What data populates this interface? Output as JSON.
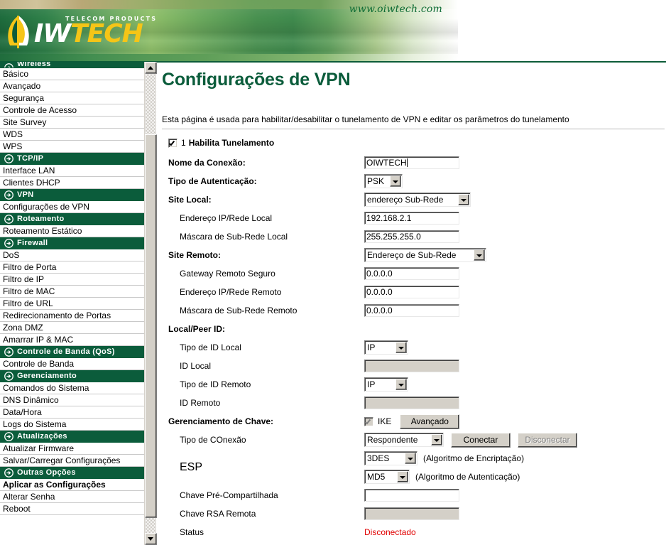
{
  "banner": {
    "url_text": "www.oiwtech.com",
    "logo_tagline": "TELECOM PRODUCTS",
    "logo_iw": "IW",
    "logo_tech": "TECH",
    "brand_green": "#0b5c3b",
    "brand_yellow": "#f5c517"
  },
  "sidebar": {
    "items": [
      {
        "label": "Wireless",
        "type": "section",
        "clipped": true
      },
      {
        "label": "Básico",
        "type": "item"
      },
      {
        "label": "Avançado",
        "type": "item"
      },
      {
        "label": "Segurança",
        "type": "item"
      },
      {
        "label": "Controle de Acesso",
        "type": "item"
      },
      {
        "label": "Site Survey",
        "type": "item"
      },
      {
        "label": "WDS",
        "type": "item"
      },
      {
        "label": "WPS",
        "type": "item"
      },
      {
        "label": "TCP/IP",
        "type": "section"
      },
      {
        "label": "Interface LAN",
        "type": "item"
      },
      {
        "label": "Clientes DHCP",
        "type": "item"
      },
      {
        "label": "VPN",
        "type": "section"
      },
      {
        "label": "Configurações de VPN",
        "type": "item"
      },
      {
        "label": "Roteamento",
        "type": "section"
      },
      {
        "label": "Roteamento Estático",
        "type": "item"
      },
      {
        "label": "Firewall",
        "type": "section"
      },
      {
        "label": "DoS",
        "type": "item"
      },
      {
        "label": "Filtro de Porta",
        "type": "item"
      },
      {
        "label": "Filtro de IP",
        "type": "item"
      },
      {
        "label": "Filtro de MAC",
        "type": "item"
      },
      {
        "label": "Filtro de URL",
        "type": "item"
      },
      {
        "label": "Redirecionamento de Portas",
        "type": "item"
      },
      {
        "label": "Zona DMZ",
        "type": "item"
      },
      {
        "label": "Amarrar IP & MAC",
        "type": "item"
      },
      {
        "label": "Controle de Banda (QoS)",
        "type": "section"
      },
      {
        "label": "Controle de Banda",
        "type": "item"
      },
      {
        "label": "Gerenciamento",
        "type": "section"
      },
      {
        "label": "Comandos do Sistema",
        "type": "item"
      },
      {
        "label": "DNS Dinâmico",
        "type": "item"
      },
      {
        "label": "Data/Hora",
        "type": "item"
      },
      {
        "label": "Logs do Sistema",
        "type": "item"
      },
      {
        "label": "Atualizações",
        "type": "section"
      },
      {
        "label": "Atualizar Firmware",
        "type": "item"
      },
      {
        "label": "Salvar/Carregar Configurações",
        "type": "item"
      },
      {
        "label": "Outras Opções",
        "type": "section"
      },
      {
        "label": "Aplicar as Configurações",
        "type": "item",
        "bold": true
      },
      {
        "label": "Alterar Senha",
        "type": "item"
      },
      {
        "label": "Reboot",
        "type": "item"
      }
    ]
  },
  "main": {
    "title": "Configurações de VPN",
    "description": "Esta página é usada para habilitar/desabilitar o tunelamento de VPN e editar os parâmetros do tunelamento",
    "enable": {
      "number": "1",
      "label": "Habilita Tunelamento",
      "checked": true
    },
    "fields": {
      "connection_name_label": "Nome da Conexão:",
      "connection_name_value": "OIWTECH",
      "auth_type_label": "Tipo de Autenticação:",
      "auth_type_value": "PSK",
      "local_site_label": "Site Local:",
      "local_site_value": "endereço Sub-Rede",
      "local_ip_label": "Endereço IP/Rede Local",
      "local_ip_value": "192.168.2.1",
      "local_mask_label": "Máscara de Sub-Rede Local",
      "local_mask_value": "255.255.255.0",
      "remote_site_label": "Site Remoto:",
      "remote_site_value": "Endereço de Sub-Rede",
      "remote_gateway_label": "Gateway Remoto Seguro",
      "remote_gateway_value": "0.0.0.0",
      "remote_ip_label": "Endereço IP/Rede Remoto",
      "remote_ip_value": "0.0.0.0",
      "remote_mask_label": "Máscara de Sub-Rede Remoto",
      "remote_mask_value": "0.0.0.0",
      "local_peer_id_label": "Local/Peer ID:",
      "local_id_type_label": "Tipo de ID Local",
      "local_id_type_value": "IP",
      "local_id_label": "ID Local",
      "local_id_value": "",
      "remote_id_type_label": "Tipo de ID Remoto",
      "remote_id_type_value": "IP",
      "remote_id_label": "ID Remoto",
      "remote_id_value": "",
      "key_mgmt_label": "Gerenciamento de Chave:",
      "ike_label": "IKE",
      "ike_checked": true,
      "advanced_button": "Avançado",
      "conn_type_label": "Tipo de COnexão",
      "conn_type_value": "Respondente",
      "connect_button": "Conectar",
      "disconnect_button": "Disconectar",
      "esp_label": "ESP",
      "esp_encryption_value": "3DES",
      "esp_encryption_note": "(Algoritmo de Encriptação)",
      "esp_auth_value": "MD5",
      "esp_auth_note": "(Algoritmo de Autenticação)",
      "psk_label": "Chave Pré-Compartilhada",
      "psk_value": "",
      "rsa_label": "Chave RSA Remota",
      "rsa_value": "",
      "status_label": "Status",
      "status_value": "Disconectado",
      "status_color": "#e00000"
    }
  }
}
